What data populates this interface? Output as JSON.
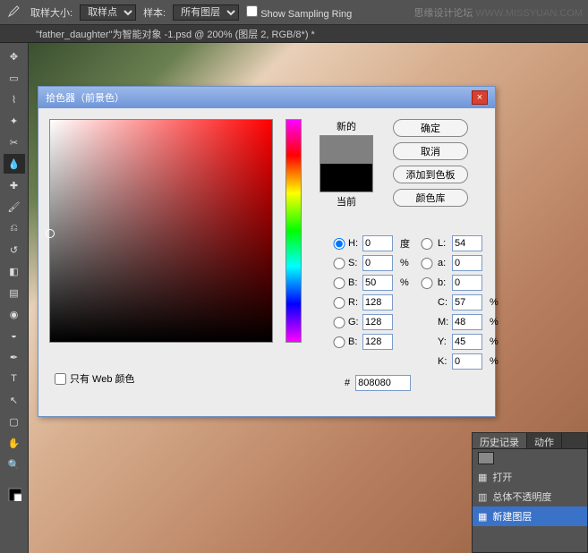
{
  "topbar": {
    "sample_label": "取样大小:",
    "sample_value": "取样点",
    "layers_label": "样本:",
    "layers_value": "所有图层",
    "ring": "Show Sampling Ring"
  },
  "watermark": {
    "site": "思缘设计论坛",
    "url": "WWW.MISSYUAN.COM"
  },
  "tab": {
    "title": "\"father_daughter\"为智能对象 -1.psd @ 200% (图层 2, RGB/8*) *"
  },
  "dialog": {
    "title": "拾色器（前景色）",
    "new_label": "新的",
    "current_label": "当前",
    "ok": "确定",
    "cancel": "取消",
    "add": "添加到色板",
    "lib": "颜色库",
    "webonly": "只有 Web 颜色",
    "H": "0",
    "S": "0",
    "Bv": "50",
    "L": "54",
    "a": "0",
    "b": "0",
    "R": "128",
    "G": "128",
    "Bc": "128",
    "C": "57",
    "M": "48",
    "Y": "45",
    "K": "0",
    "deg": "度",
    "pct": "%",
    "hex_label": "#",
    "hex": "808080",
    "new_color": "#808080",
    "cur_color": "#000000"
  },
  "history": {
    "tab1": "历史记录",
    "tab2": "动作",
    "items": [
      "打开",
      "总体不透明度",
      "新建图层"
    ]
  }
}
